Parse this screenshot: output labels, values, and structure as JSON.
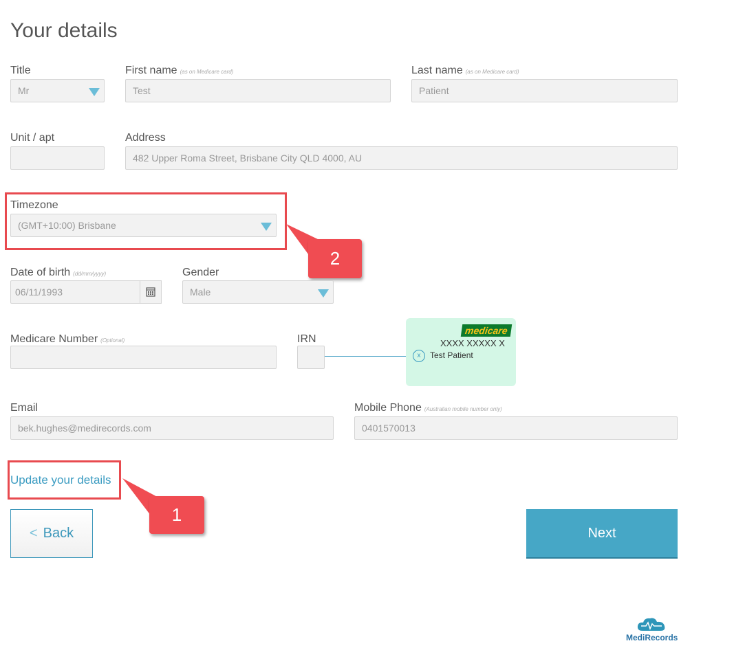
{
  "page": {
    "title": "Your details"
  },
  "form": {
    "title": {
      "label": "Title",
      "value": "Mr"
    },
    "first_name": {
      "label": "First name",
      "hint": "(as on Medicare card)",
      "value": "Test"
    },
    "last_name": {
      "label": "Last name",
      "hint": "(as on Medicare card)",
      "value": "Patient"
    },
    "unit": {
      "label": "Unit / apt",
      "value": ""
    },
    "address": {
      "label": "Address",
      "value": "482 Upper Roma Street, Brisbane City QLD 4000, AU"
    },
    "timezone": {
      "label": "Timezone",
      "value": "(GMT+10:00) Brisbane"
    },
    "dob": {
      "label": "Date of birth",
      "hint": "(dd/mm/yyyy)",
      "value": "06/11/1993"
    },
    "gender": {
      "label": "Gender",
      "value": "Male"
    },
    "medicare_number": {
      "label": "Medicare Number",
      "hint": "(Optional)",
      "value": ""
    },
    "irn": {
      "label": "IRN",
      "value": ""
    },
    "email": {
      "label": "Email",
      "value": "bek.hughes@medirecords.com"
    },
    "mobile": {
      "label": "Mobile Phone",
      "hint": "(Australian mobile number only)",
      "value": "0401570013"
    }
  },
  "medicare_card": {
    "brand": "medicare",
    "number": "XXXX XXXXX X",
    "marker": "x",
    "name": "Test Patient"
  },
  "links": {
    "update_details": "Update your details"
  },
  "buttons": {
    "back": "Back",
    "back_icon": "<",
    "next": "Next"
  },
  "annotations": {
    "callout_1": "1",
    "callout_2": "2"
  },
  "logo": {
    "text": "MediRecords"
  },
  "colors": {
    "accent": "#46a7c6",
    "callout": "#f04c52",
    "link": "#3a9bc1",
    "medicare_green": "#0c7a2c",
    "card_bg": "#d4f7e6"
  }
}
